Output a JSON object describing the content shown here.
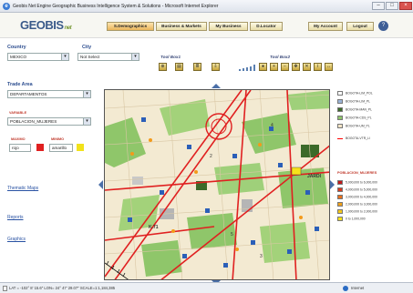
{
  "window": {
    "title": "Geobis Net Engine Geographic Business Intelligence System & Solutions - Microsoft Internet Explorer"
  },
  "header": {
    "logo_text": "GEOBIS",
    "logo_sub": "net",
    "nav": [
      {
        "label": "S.Demographics"
      },
      {
        "label": "Business & Markets"
      },
      {
        "label": "My Business"
      },
      {
        "label": "D.Locator"
      }
    ],
    "my_account": "My Account",
    "logout": "Logout",
    "help": "?"
  },
  "filters": {
    "country_label": "Country",
    "country_value": "MEXICO",
    "city_label": "City",
    "city_value": "Not Select"
  },
  "toolbox1": {
    "label": "Tool Box1"
  },
  "toolbox2": {
    "label": "Tool Box2"
  },
  "left": {
    "trade_area_label": "Trade Area",
    "trade_area_value": "DEPARTAMENTOS",
    "variable_label": "VARIABLE",
    "variable_value": "POBLACION_MUJERES",
    "maximo_label": "MAXIMO",
    "minimo_label": "MINIMO",
    "max_value": "rojo",
    "min_value": "amarillo",
    "max_color": "#e02020",
    "min_color": "#f2e21a",
    "links": [
      "Thematic Maps",
      "Reports",
      "Graphics"
    ]
  },
  "map": {
    "labels": [
      "K.71",
      "JARDI",
      "3",
      "4",
      "5",
      "2"
    ]
  },
  "legend": {
    "layers": [
      {
        "name": "BOGOTA-LIM_POL",
        "color": "#ffffff"
      },
      {
        "name": "BOGOTA-LIM_PL",
        "color": "#9bb4d8"
      },
      {
        "name": "BOGOTA-MAN_PL",
        "color": "#3c6a2a"
      },
      {
        "name": "BOGOTA-CDS_PL",
        "color": "#8ec46a"
      },
      {
        "name": "BOGOTA-UM_PL",
        "color": "#f4e6c8"
      },
      {
        "name": "BOGOTA-VTR_LI",
        "color": "#ff0000"
      }
    ],
    "thematic_title": "POBLACION_MUJERES",
    "ranges": [
      {
        "label": "5,000,000 to 6,000,000",
        "color": "#c0181a"
      },
      {
        "label": "4,000,000 to 5,000,000",
        "color": "#d83a1e"
      },
      {
        "label": "3,000,000 to 4,000,000",
        "color": "#e8701c"
      },
      {
        "label": "2,000,000 to 3,000,000",
        "color": "#f0a01a"
      },
      {
        "label": "1,000,000 to 2,000,000",
        "color": "#f5c81a"
      },
      {
        "label": "0 to 1,000,000",
        "color": "#f7e21a"
      }
    ]
  },
  "status": {
    "coords": "LAT = -102° 8' 15.6\"  LON= 24° 47' 29.07\"  SCALE=1:1,184,385",
    "zone": "Internet"
  }
}
